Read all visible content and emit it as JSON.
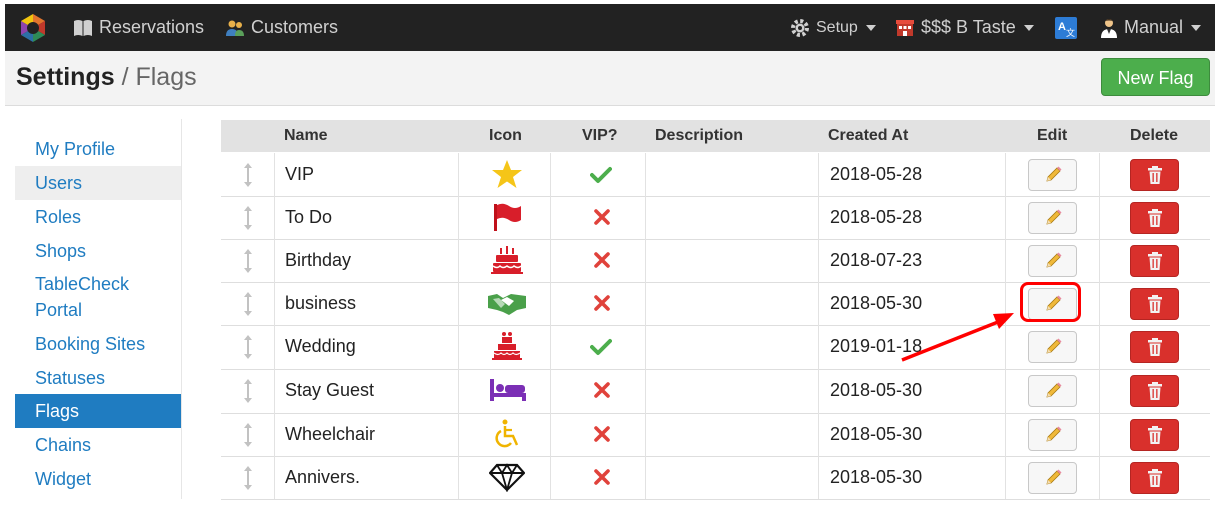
{
  "nav": {
    "reservations": "Reservations",
    "customers": "Customers",
    "setup": "Setup",
    "shop": "$$$ B Taste",
    "user": "Manual"
  },
  "header": {
    "title_bold": "Settings",
    "title_sep": " / ",
    "title_sub": "Flags",
    "new_flag": "New Flag"
  },
  "sidebar": {
    "items": [
      {
        "label": "My Profile"
      },
      {
        "label": "Users"
      },
      {
        "label": "Roles"
      },
      {
        "label": "Shops"
      },
      {
        "label": "TableCheck Portal"
      },
      {
        "label": "Booking Sites"
      },
      {
        "label": "Statuses"
      },
      {
        "label": "Flags"
      },
      {
        "label": "Chains"
      },
      {
        "label": "Widget"
      }
    ]
  },
  "table": {
    "headers": {
      "name": "Name",
      "icon": "Icon",
      "vip": "VIP?",
      "description": "Description",
      "created_at": "Created At",
      "edit": "Edit",
      "delete": "Delete"
    },
    "rows": [
      {
        "name": "VIP",
        "icon": "star-icon",
        "vip": true,
        "description": "",
        "created_at": "2018-05-28"
      },
      {
        "name": "To Do",
        "icon": "flag-icon",
        "vip": false,
        "description": "",
        "created_at": "2018-05-28"
      },
      {
        "name": "Birthday",
        "icon": "birthday-cake-icon",
        "vip": false,
        "description": "",
        "created_at": "2018-07-23"
      },
      {
        "name": "business",
        "icon": "handshake-icon",
        "vip": false,
        "description": "",
        "created_at": "2018-05-30"
      },
      {
        "name": "Wedding",
        "icon": "wedding-cake-icon",
        "vip": true,
        "description": "",
        "created_at": "2019-01-18"
      },
      {
        "name": "Stay Guest",
        "icon": "bed-icon",
        "vip": false,
        "description": "",
        "created_at": "2018-05-30"
      },
      {
        "name": "Wheelchair",
        "icon": "wheelchair-icon",
        "vip": false,
        "description": "",
        "created_at": "2018-05-30"
      },
      {
        "name": "Annivers.",
        "icon": "diamond-icon",
        "vip": false,
        "description": "",
        "created_at": "2018-05-30"
      }
    ]
  },
  "colors": {
    "nav_bg": "#222222",
    "link": "#1f7cc1",
    "success": "#4cae4c",
    "danger": "#d9302c",
    "highlight": "#ff0000"
  }
}
